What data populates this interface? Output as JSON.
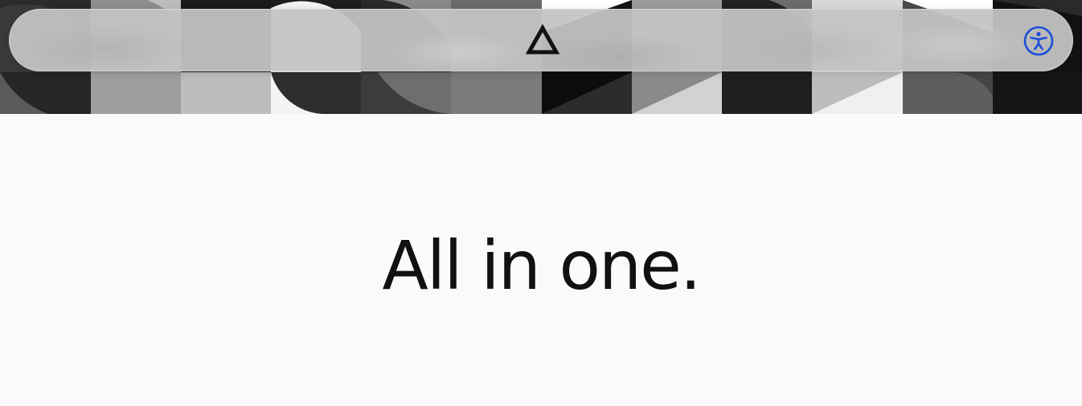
{
  "navbar": {
    "logo_icon": "triangle-logo-icon",
    "accessibility_icon": "accessibility-person-icon",
    "accessibility_color": "#1d4ed8"
  },
  "hero": {
    "headline": "All in one."
  },
  "colors": {
    "page_background": "#fafafa",
    "headline": "#111111",
    "navbar_glass": "#c4c4c4"
  }
}
